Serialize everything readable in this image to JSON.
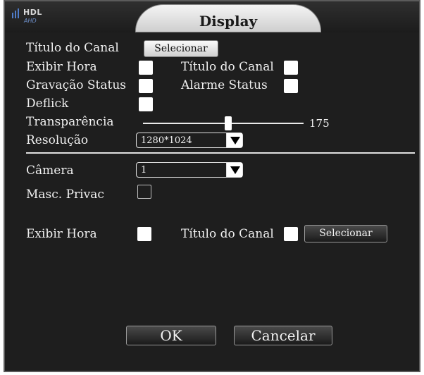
{
  "window": {
    "title": "Display"
  },
  "logo": {
    "text": "HDL",
    "sub": "AHD"
  },
  "rows": {
    "channel_title": {
      "label": "Título do Canal",
      "button": "Selecionar"
    },
    "show_time": {
      "label": "Exibir Hora",
      "checked": true
    },
    "channel_title_check": {
      "label": "Título do Canal",
      "checked": true
    },
    "recording_status": {
      "label": "Gravação Status",
      "checked": true
    },
    "alarm_status": {
      "label": "Alarme Status",
      "checked": true
    },
    "deflick": {
      "label": "Deflick",
      "checked": true
    },
    "transparency": {
      "label": "Transparência",
      "value": "175",
      "fraction": 0.53
    },
    "resolution": {
      "label": "Resolução",
      "value": "1280*1024"
    }
  },
  "camera_section": {
    "camera": {
      "label": "Câmera",
      "value": "1"
    },
    "privacy_mask": {
      "label": "Masc. Privac",
      "checked": false
    },
    "show_time": {
      "label": "Exibir Hora",
      "checked": true
    },
    "channel_title": {
      "label": "Título do Canal",
      "checked": true,
      "button": "Selecionar"
    }
  },
  "footer": {
    "ok": "OK",
    "cancel": "Cancelar"
  }
}
